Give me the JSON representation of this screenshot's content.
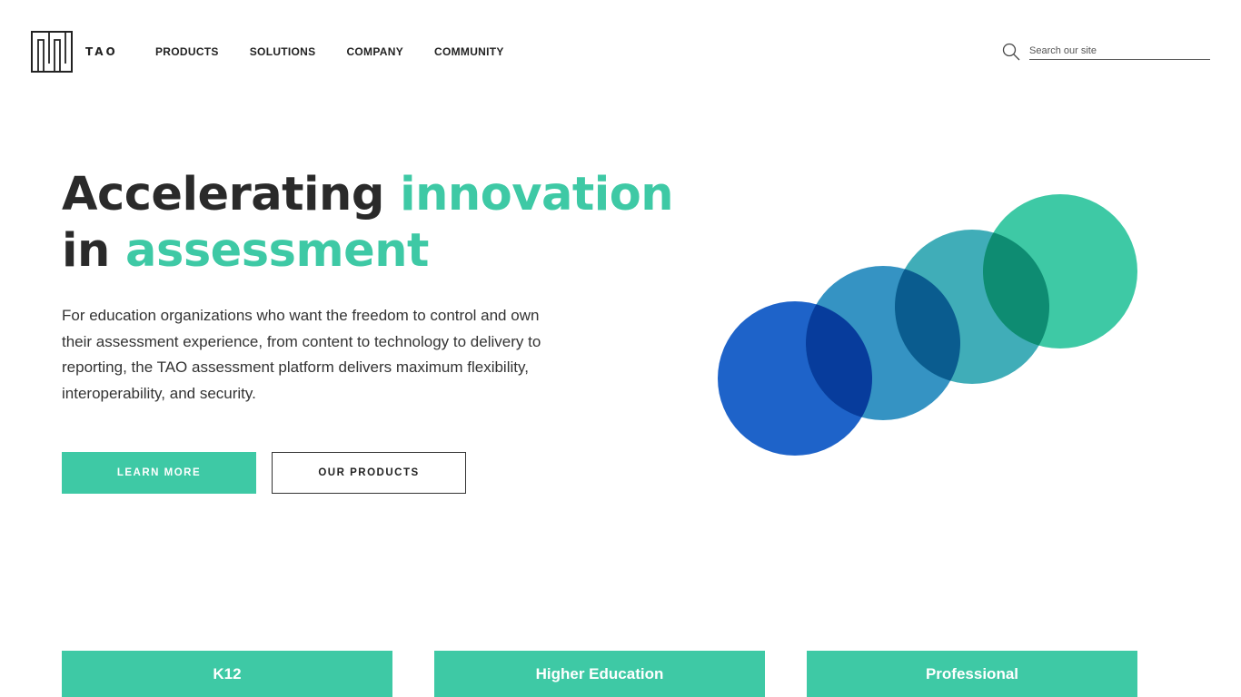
{
  "brand": {
    "name": "TAO",
    "accent_color": "#3ec9a5"
  },
  "nav": {
    "items": [
      {
        "label": "PRODUCTS"
      },
      {
        "label": "SOLUTIONS"
      },
      {
        "label": "COMPANY"
      },
      {
        "label": "COMMUNITY"
      }
    ]
  },
  "search": {
    "placeholder": "Search our site",
    "icon": "search-icon"
  },
  "hero": {
    "headline_part1": "Accelerating ",
    "headline_accent1": "innovation",
    "headline_part2": "in ",
    "headline_accent2": "assessment",
    "description": "For education organizations who want the freedom to control and own their assessment experience, from content to technology to delivery to reporting, the TAO assessment platform delivers maximum flexibility, interoperability, and security.",
    "primary_button": "LEARN MORE",
    "secondary_button": "OUR PRODUCTS",
    "circle_colors": [
      "#1e63c9",
      "#2a8dc0",
      "#36a9b4",
      "#3ec9a5"
    ]
  },
  "cards": [
    {
      "label": "K12"
    },
    {
      "label": "Higher Education"
    },
    {
      "label": "Professional"
    }
  ]
}
